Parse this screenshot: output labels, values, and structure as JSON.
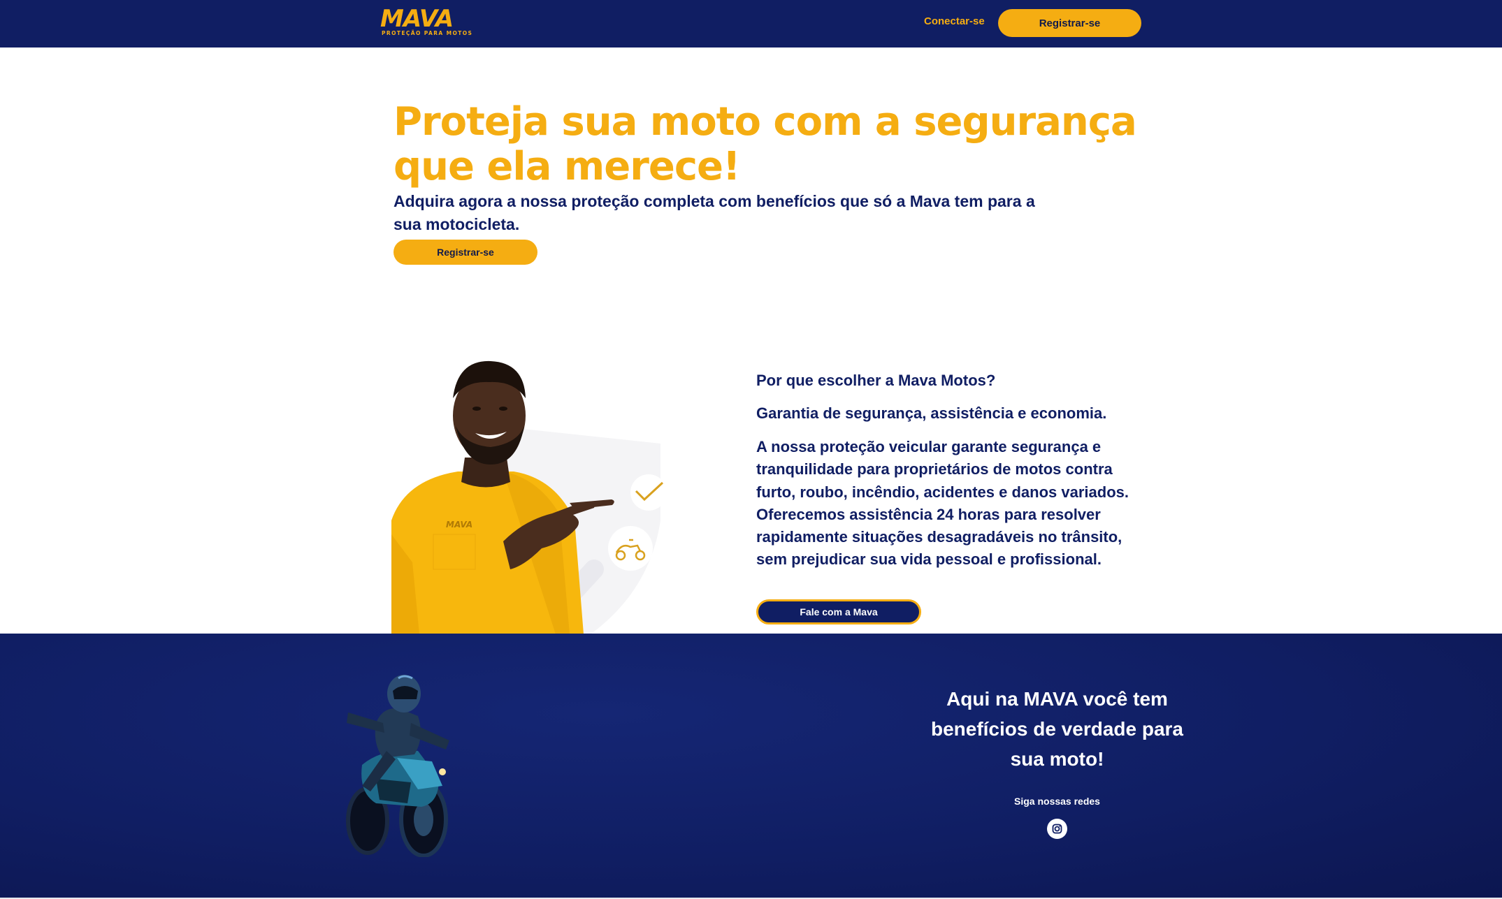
{
  "header": {
    "logo_text": "MAVA",
    "logo_tagline": "PROTEÇÃO PARA MOTOS",
    "login_label": "Conectar-se",
    "register_label": "Registrar-se"
  },
  "hero": {
    "title": "Proteja sua moto com a segurança que ela merece!",
    "subtitle": "Adquira agora a nossa proteção completa com benefícios que só a Mava tem para a sua motocicleta.",
    "button_label": "Registrar-se"
  },
  "why": {
    "question": "Por que escolher a Mava Motos?",
    "tagline": "Garantia de segurança, assistência e economia.",
    "body": "A nossa proteção veicular garante segurança e tranquilidade para proprietários de motos contra furto, roubo, incêndio, acidentes e danos variados. Oferecemos assistência 24 horas para resolver rapidamente situações desagradáveis no trânsito, sem prejudicar sua vida pessoal e profissional.",
    "button_label": "Fale com a Mava"
  },
  "person": {
    "shirt_logo": "MAVA"
  },
  "footer": {
    "title": "Aqui na MAVA você tem benefícios de verdade para sua moto!",
    "follow_label": "Siga nossas redes",
    "social_icon": "instagram-icon"
  },
  "colors": {
    "navy": "#101e63",
    "gold": "#f5ad12",
    "white": "#ffffff"
  }
}
